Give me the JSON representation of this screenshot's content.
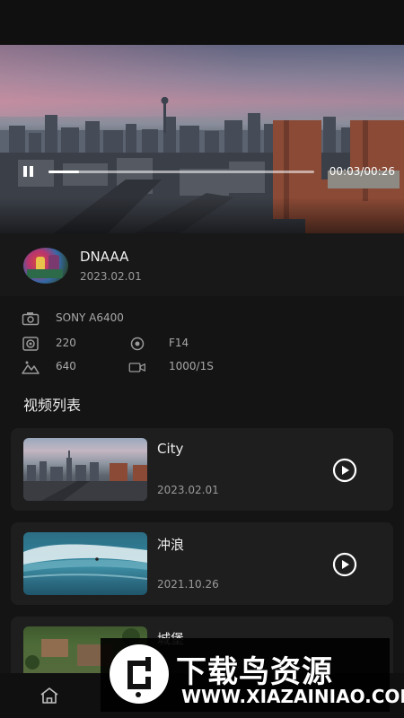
{
  "player": {
    "time": "00:03/00:26",
    "progress": 0.115
  },
  "author": {
    "name": "DNAAA",
    "date": "2023.02.01"
  },
  "specs": {
    "camera": "SONY A6400",
    "iso": "220",
    "aperture": "F14",
    "exposure": "640",
    "shutter": "1000/1S"
  },
  "video_list": {
    "title": "视频列表",
    "items": [
      {
        "title": "City",
        "date": "2023.02.01"
      },
      {
        "title": "冲浪",
        "date": "2021.10.26"
      },
      {
        "title": "城堡",
        "date": ""
      }
    ]
  },
  "watermark": {
    "title": "下载鸟资源",
    "url": "WWW.XIAZAINIAO.COM"
  },
  "colors": {
    "background": "#141414",
    "card": "#1e1e1e",
    "text": "#e6e6e6",
    "muted": "#9a9a9a"
  }
}
